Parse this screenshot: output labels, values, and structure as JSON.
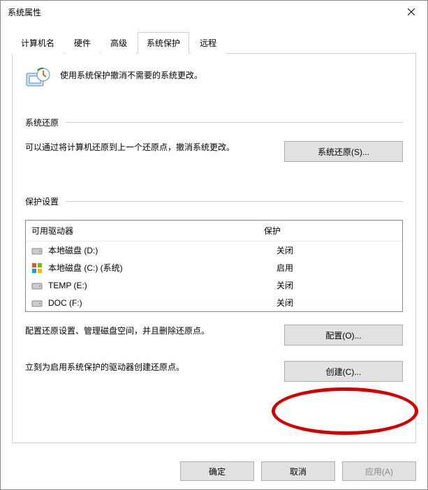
{
  "window": {
    "title": "系统属性"
  },
  "tabs": {
    "computer_name": "计算机名",
    "hardware": "硬件",
    "advanced": "高级",
    "system_protection": "系统保护",
    "remote": "远程"
  },
  "intro": {
    "text": "使用系统保护撤消不需要的系统更改。"
  },
  "restore": {
    "heading": "系统还原",
    "text": "可以通过将计算机还原到上一个还原点，撤消系统更改。",
    "button": "系统还原(S)..."
  },
  "protection": {
    "heading": "保护设置",
    "col_drive": "可用驱动器",
    "col_protect": "保护",
    "drives": [
      {
        "name": "本地磁盘 (D:)",
        "status": "关闭",
        "icon": "hdd"
      },
      {
        "name": "本地磁盘 (C:) (系统)",
        "status": "启用",
        "icon": "winhdd"
      },
      {
        "name": "TEMP (E:)",
        "status": "关闭",
        "icon": "hdd"
      },
      {
        "name": "DOC (F:)",
        "status": "关闭",
        "icon": "hdd"
      }
    ],
    "configure_text": "配置还原设置、管理磁盘空间，并且删除还原点。",
    "configure_button": "配置(O)...",
    "create_text": "立刻为启用系统保护的驱动器创建还原点。",
    "create_button": "创建(C)..."
  },
  "footer": {
    "ok": "确定",
    "cancel": "取消",
    "apply": "应用(A)"
  }
}
